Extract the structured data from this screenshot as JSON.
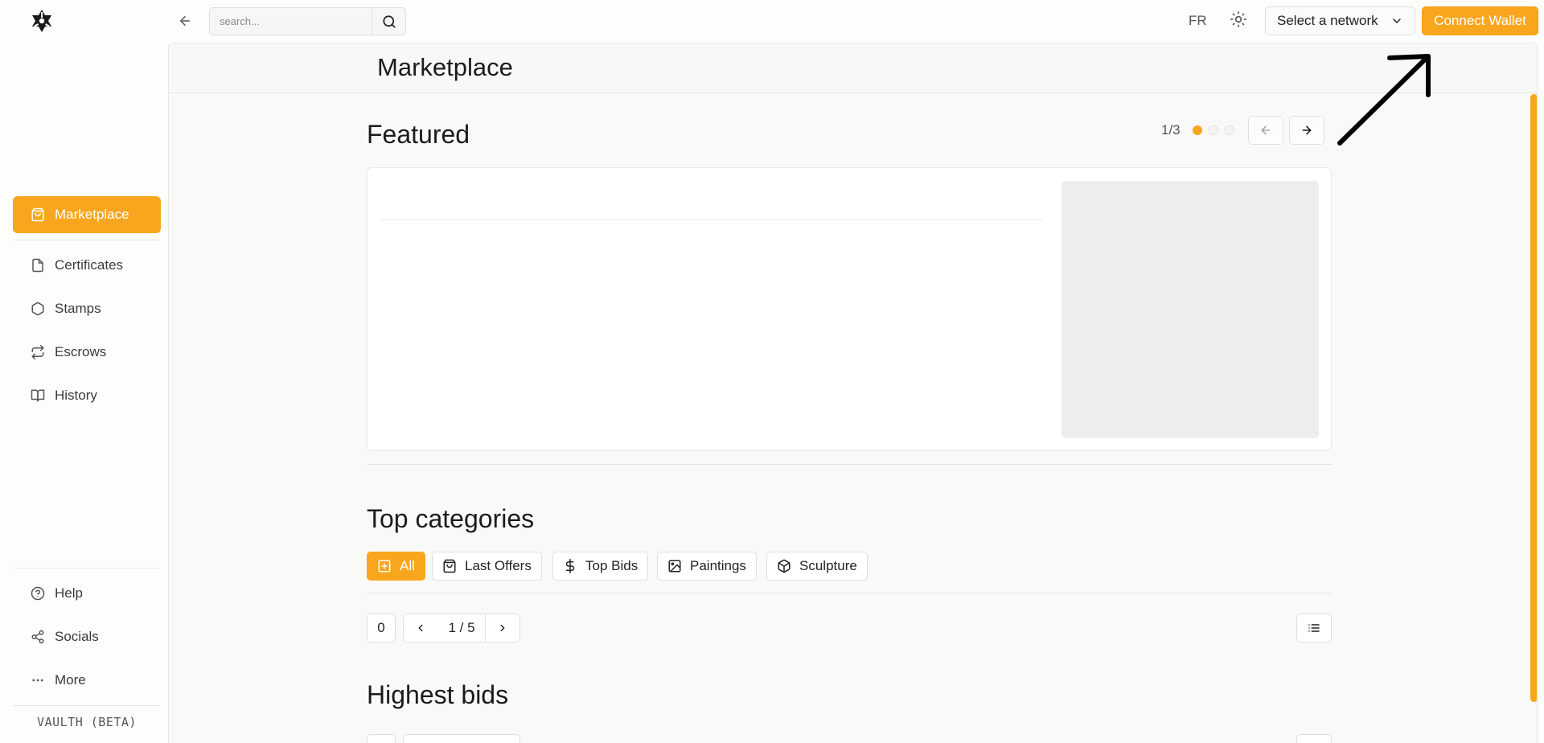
{
  "search": {
    "placeholder": "search..."
  },
  "topbar": {
    "language": "FR",
    "network_label": "Select a network",
    "connect_label": "Connect Wallet"
  },
  "sidebar": {
    "items": [
      {
        "label": "Marketplace",
        "icon": "shopping-bag-icon",
        "active": true
      },
      {
        "label": "Certificates",
        "icon": "file-icon"
      },
      {
        "label": "Stamps",
        "icon": "hexagon-icon"
      },
      {
        "label": "Escrows",
        "icon": "repeat-icon"
      },
      {
        "label": "History",
        "icon": "book-open-icon"
      }
    ],
    "bottom_items": [
      {
        "label": "Help",
        "icon": "help-circle-icon"
      },
      {
        "label": "Socials",
        "icon": "share-icon"
      },
      {
        "label": "More",
        "icon": "more-horizontal-icon"
      }
    ],
    "footer": "VAULTH (BETA)"
  },
  "page": {
    "title": "Marketplace",
    "featured": {
      "title": "Featured",
      "counter": "1/3",
      "active_slide": 1,
      "total_slides": 3
    },
    "top_categories": {
      "title": "Top categories",
      "chips": [
        {
          "label": "All",
          "icon": "plus-square-icon",
          "active": true
        },
        {
          "label": "Last Offers",
          "icon": "shopping-bag-icon"
        },
        {
          "label": "Top Bids",
          "icon": "dollar-icon"
        },
        {
          "label": "Paintings",
          "icon": "image-icon"
        },
        {
          "label": "Sculpture",
          "icon": "box-icon"
        }
      ],
      "count": "0",
      "page_indicator": "1 / 5"
    },
    "highest_bids": {
      "title": "Highest bids"
    }
  },
  "colors": {
    "accent": "#f9a61e",
    "background": "#f9f9f8"
  }
}
